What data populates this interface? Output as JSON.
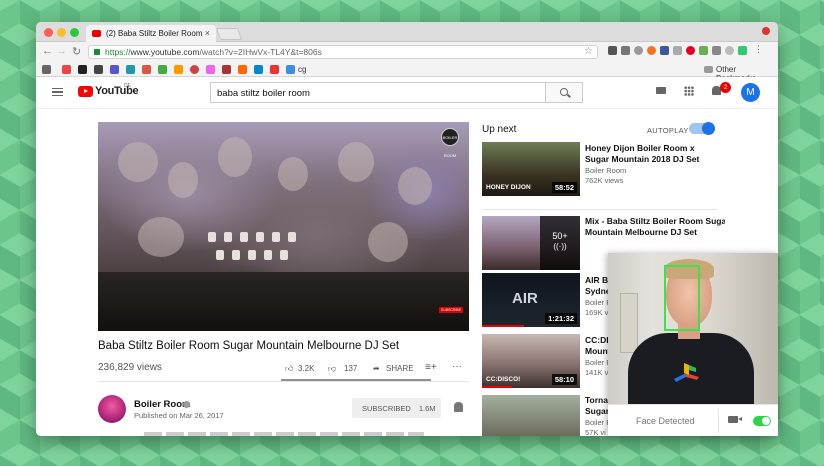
{
  "browser": {
    "tab_title": "(2) Baba Stiltz Boiler Room",
    "url_scheme": "https://",
    "url_host": "www.youtube.com",
    "url_path": "/watch?v=2IHwVx-TL4Y&t=806s",
    "bookmark_folder": "cg",
    "other_bookmarks": "Other Bookmarks"
  },
  "header": {
    "logo": "YouTube",
    "region": "DE",
    "search_query": "baba stiltz boiler room",
    "notification_count": "2",
    "avatar_letter": "M"
  },
  "video": {
    "title": "Baba Stiltz Boiler Room Sugar Mountain Melbourne DJ Set",
    "views": "236,829 views",
    "likes": "3.2K",
    "dislikes": "137",
    "share": "SHARE",
    "logo_text": "BOILER ROOM",
    "subscribe_badge": "SUBSCRIBE"
  },
  "channel": {
    "name": "Boiler Room",
    "published": "Published on Mar 26, 2017",
    "subscribe_label": "SUBSCRIBED",
    "subscriber_count": "1.6M"
  },
  "sidebar": {
    "up_next": "Up next",
    "autoplay": "AUTOPLAY",
    "items": [
      {
        "title_1": "Honey Dijon Boiler Room x",
        "title_2": "Sugar Mountain 2018 DJ Set",
        "channel": "Boiler Room",
        "views": "762K views",
        "duration": "58:52",
        "thumb_text": "HONEY DIJON"
      },
      {
        "title_1": "Mix - Baba Stiltz Boiler Room Sugar",
        "title_2": "Mountain Melbourne DJ Set",
        "overlay": "50+"
      },
      {
        "title_1": "AIR Bo",
        "title_2": "Sydney",
        "channel": "Boiler R",
        "views": "169K v",
        "duration": "1:21:32",
        "thumb_text": "AIR"
      },
      {
        "title_1": "CC:DIS",
        "title_2": "Mount",
        "channel": "Boiler R",
        "views": "141K v",
        "duration": "58:10",
        "thumb_text": "CC:DISCO!"
      },
      {
        "title_1": "Tornad",
        "title_2": "Sugar",
        "channel": "Boiler R",
        "views": "57K vi"
      }
    ]
  },
  "camera": {
    "status": "Face Detected"
  },
  "colors": {
    "accent": "#1a73e8",
    "youtube_red": "#ff0000",
    "face_box": "#3be34a",
    "toggle_on": "#2fd24d"
  }
}
